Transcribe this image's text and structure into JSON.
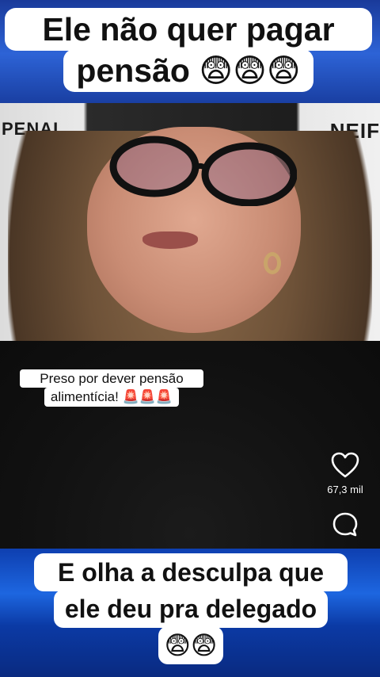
{
  "captions": {
    "top_line1": "Ele não quer pagar",
    "top_line2": "pensão",
    "top_emojis": "😨😨😨",
    "bottom_line1": "E olha a desculpa que",
    "bottom_line2": "ele deu pra delegado",
    "bottom_emojis": "😨😨"
  },
  "sticker": {
    "line1": "Preso por dever pensão",
    "line2": "alimentícia!",
    "line2_emojis": "🚨🚨🚨"
  },
  "background": {
    "left_sign": "PENAL",
    "right_sign": "NEIF"
  },
  "actions": {
    "like_icon": "heart-outline-icon",
    "like_count": "67,3 mil",
    "comment_icon": "comment-bubble-icon"
  },
  "colors": {
    "caption_bg": "#ffffff",
    "caption_text": "#111111",
    "band_blue": "#1d66e0"
  }
}
